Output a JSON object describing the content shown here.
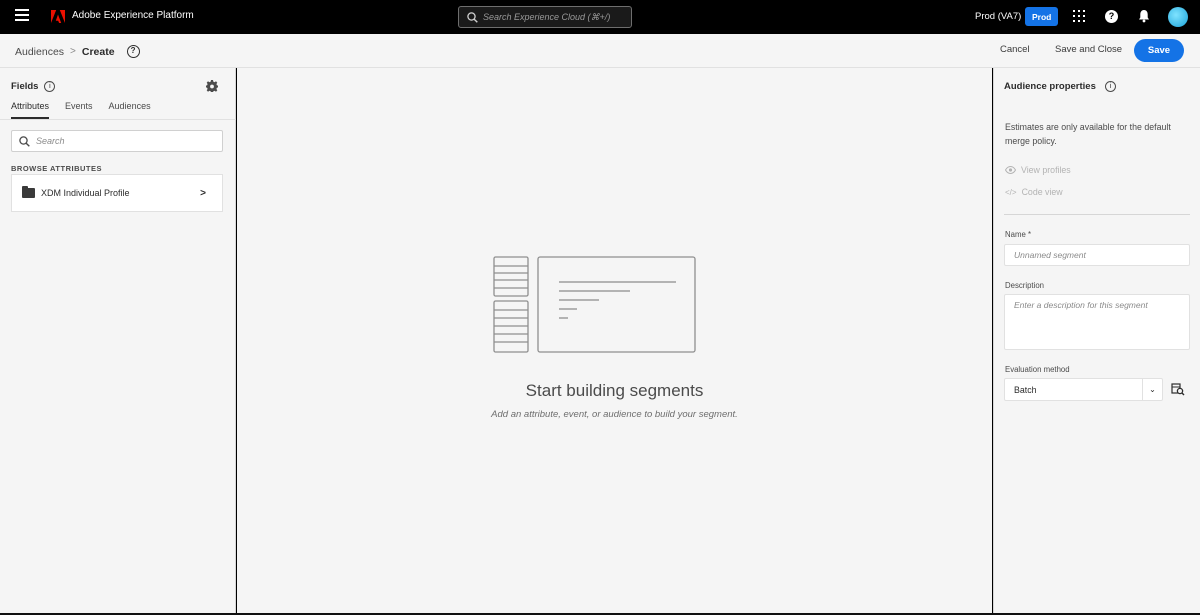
{
  "topbar": {
    "app_title": "Adobe Experience Platform",
    "search_placeholder": "Search Experience Cloud (⌘+/)",
    "org": "Prod (VA7)",
    "env_badge": "Prod",
    "help_glyph": "?",
    "icons": [
      "hamburger-icon",
      "adobe-logo",
      "search-icon",
      "apps-grid-icon",
      "help-icon",
      "bell-icon",
      "avatar"
    ],
    "accent_color": "#1473e6"
  },
  "subheader": {
    "breadcrumb_root": "Audiences",
    "breadcrumb_sep": ">",
    "breadcrumb_current": "Create",
    "help_glyph": "?",
    "cancel_label": "Cancel",
    "save_close_label": "Save and Close",
    "save_label": "Save"
  },
  "left_panel": {
    "title": "Fields",
    "info_glyph": "i",
    "tabs": [
      "Attributes",
      "Events",
      "Audiences"
    ],
    "active_tab": "Attributes",
    "search_placeholder": "Search",
    "browse_label": "BROWSE ATTRIBUTES",
    "items": [
      {
        "label": "XDM Individual Profile",
        "chevron": ">"
      }
    ]
  },
  "canvas": {
    "empty_title": "Start building segments",
    "empty_subtitle": "Add an attribute, event, or audience to build your segment."
  },
  "right_panel": {
    "title": "Audience properties",
    "info_glyph": "i",
    "note": "Estimates are only available for the default merge policy.",
    "view_profiles_label": "View profiles",
    "code_view_icon": "</>",
    "code_view_label": "Code view",
    "name_label": "Name *",
    "name_placeholder": "Unnamed segment",
    "description_label": "Description",
    "description_placeholder": "Enter a description for this segment",
    "evaluation_label": "Evaluation method",
    "evaluation_value": "Batch",
    "select_chevron": "⌄"
  }
}
